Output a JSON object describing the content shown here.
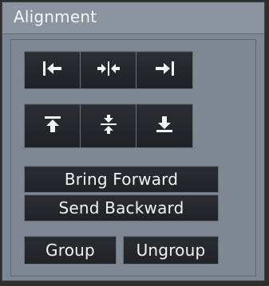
{
  "panel": {
    "title": "Alignment"
  },
  "alignment_buttons": [
    {
      "icon": "align-left-icon"
    },
    {
      "icon": "align-center-horizontal-icon"
    },
    {
      "icon": "align-right-icon"
    },
    {
      "icon": "align-top-icon"
    },
    {
      "icon": "align-center-vertical-icon"
    },
    {
      "icon": "align-bottom-icon"
    }
  ],
  "order_buttons": {
    "bring_forward": "Bring Forward",
    "send_backward": "Send Backward"
  },
  "group_buttons": {
    "group": "Group",
    "ungroup": "Ungroup"
  },
  "colors": {
    "panel_bg": "#7e8794",
    "button_bg": "#24272b",
    "text": "#f2f4f6"
  }
}
